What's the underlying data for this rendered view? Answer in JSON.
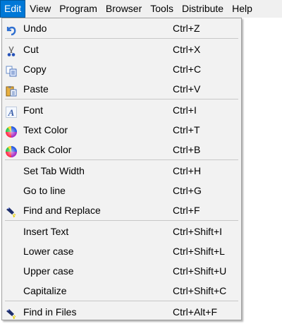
{
  "menubar": [
    "Edit",
    "View",
    "Program",
    "Browser",
    "Tools",
    "Distribute",
    "Help"
  ],
  "menu": {
    "groups": [
      [
        {
          "label": "Undo",
          "shortcut": "Ctrl+Z",
          "icon": "undo-icon"
        }
      ],
      [
        {
          "label": "Cut",
          "shortcut": "Ctrl+X",
          "icon": "cut-icon"
        },
        {
          "label": "Copy",
          "shortcut": "Ctrl+C",
          "icon": "copy-icon"
        },
        {
          "label": "Paste",
          "shortcut": "Ctrl+V",
          "icon": "paste-icon"
        }
      ],
      [
        {
          "label": "Font",
          "shortcut": "Ctrl+I",
          "icon": "font-icon"
        },
        {
          "label": "Text Color",
          "shortcut": "Ctrl+T",
          "icon": "color-wheel-icon"
        },
        {
          "label": "Back Color",
          "shortcut": "Ctrl+B",
          "icon": "color-wheel-icon"
        }
      ],
      [
        {
          "label": "Set Tab Width",
          "shortcut": "Ctrl+H",
          "icon": ""
        },
        {
          "label": "Go to line",
          "shortcut": "Ctrl+G",
          "icon": ""
        },
        {
          "label": "Find and Replace",
          "shortcut": "Ctrl+F",
          "icon": "flashlight-icon"
        }
      ],
      [
        {
          "label": "Insert Text",
          "shortcut": "Ctrl+Shift+I",
          "icon": ""
        },
        {
          "label": "Lower case",
          "shortcut": "Ctrl+Shift+L",
          "icon": ""
        },
        {
          "label": "Upper case",
          "shortcut": "Ctrl+Shift+U",
          "icon": ""
        },
        {
          "label": "Capitalize",
          "shortcut": "Ctrl+Shift+C",
          "icon": ""
        }
      ],
      [
        {
          "label": "Find in Files",
          "shortcut": "Ctrl+Alt+F",
          "icon": "flashlight-icon"
        }
      ]
    ]
  }
}
